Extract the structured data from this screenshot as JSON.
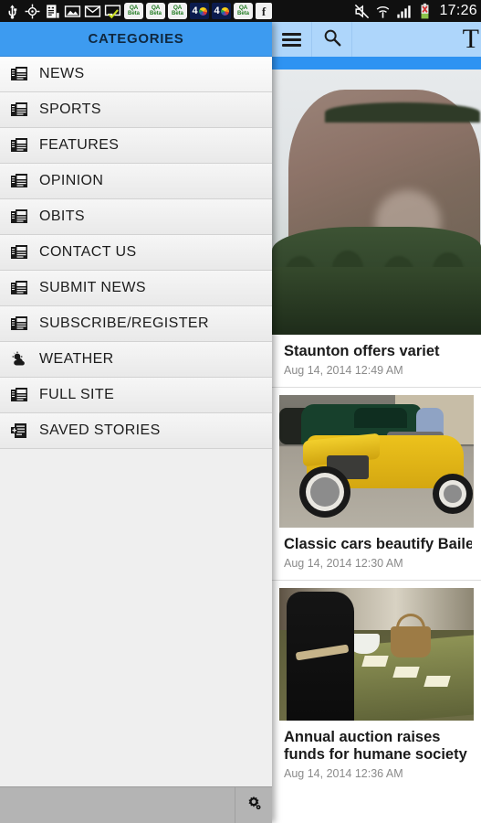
{
  "status_bar": {
    "clock": "17:26",
    "left_icons": [
      {
        "name": "usb-icon",
        "label": "USB"
      },
      {
        "name": "location-icon",
        "label": "GPS"
      },
      {
        "name": "sd-card-icon",
        "label": "Storage"
      },
      {
        "name": "screenshot-icon",
        "label": "Screenshot"
      },
      {
        "name": "gmail-icon",
        "label": "Gmail"
      },
      {
        "name": "message-sent-icon",
        "label": "Message"
      }
    ],
    "qa_badges": [
      {
        "name": "qa-beta-badge",
        "top": "QA",
        "bottom": "Beta"
      },
      {
        "name": "qa-beta-badge",
        "top": "QA",
        "bottom": "Beta"
      },
      {
        "name": "qa-beta-badge",
        "top": "QA",
        "bottom": "Beta"
      }
    ],
    "nbc_badges": [
      {
        "name": "nbc4-badge",
        "number": "4"
      },
      {
        "name": "nbc4-badge",
        "number": "4"
      }
    ],
    "qa_badge_tail": {
      "name": "qa-beta-badge",
      "top": "QA",
      "bottom": "Beta"
    },
    "facebook_badge": {
      "name": "facebook-icon",
      "glyph": "f"
    },
    "right_icons": [
      {
        "name": "mute-icon",
        "label": "Silent"
      },
      {
        "name": "wifi-icon",
        "label": "Wi-Fi"
      },
      {
        "name": "signal-icon",
        "label": "Signal"
      },
      {
        "name": "battery-error-icon",
        "label": "Battery"
      }
    ]
  },
  "drawer": {
    "header_title": "CATEGORIES",
    "header_color": "#3d9bf0",
    "items": [
      {
        "label": "NEWS",
        "icon": "newspaper-icon"
      },
      {
        "label": "SPORTS",
        "icon": "newspaper-icon"
      },
      {
        "label": "FEATURES",
        "icon": "newspaper-icon"
      },
      {
        "label": "OPINION",
        "icon": "newspaper-icon"
      },
      {
        "label": "OBITS",
        "icon": "newspaper-icon"
      },
      {
        "label": "CONTACT US",
        "icon": "newspaper-icon"
      },
      {
        "label": "SUBMIT NEWS",
        "icon": "newspaper-icon"
      },
      {
        "label": "SUBSCRIBE/REGISTER",
        "icon": "newspaper-icon"
      },
      {
        "label": "WEATHER",
        "icon": "sun-cloud-icon"
      },
      {
        "label": "FULL SITE",
        "icon": "newspaper-icon"
      },
      {
        "label": "SAVED STORIES",
        "icon": "save-document-icon"
      }
    ]
  },
  "content": {
    "toolbar": {
      "menu_icon": "hamburger-menu-icon",
      "search_icon": "search-icon",
      "masthead": "T",
      "background_color": "#aed6fb",
      "accent_color": "#2e93f2"
    },
    "articles": [
      {
        "headline": "Staunton offers variet",
        "timestamp": "Aug 14, 2014 12:49 AM",
        "image": "mountain-butte-photo",
        "wrap": false
      },
      {
        "headline": "Classic cars beautify Bailey",
        "timestamp": "Aug 14, 2014 12:30 AM",
        "image": "yellow-hot-rod-photo",
        "wrap": false
      },
      {
        "headline": "Annual auction raises funds for humane society",
        "timestamp": "Aug 14, 2014 12:36 AM",
        "image": "auction-table-photo",
        "wrap": true
      }
    ]
  },
  "system_bar": {
    "menu_icon": "settings-gear-icon"
  }
}
